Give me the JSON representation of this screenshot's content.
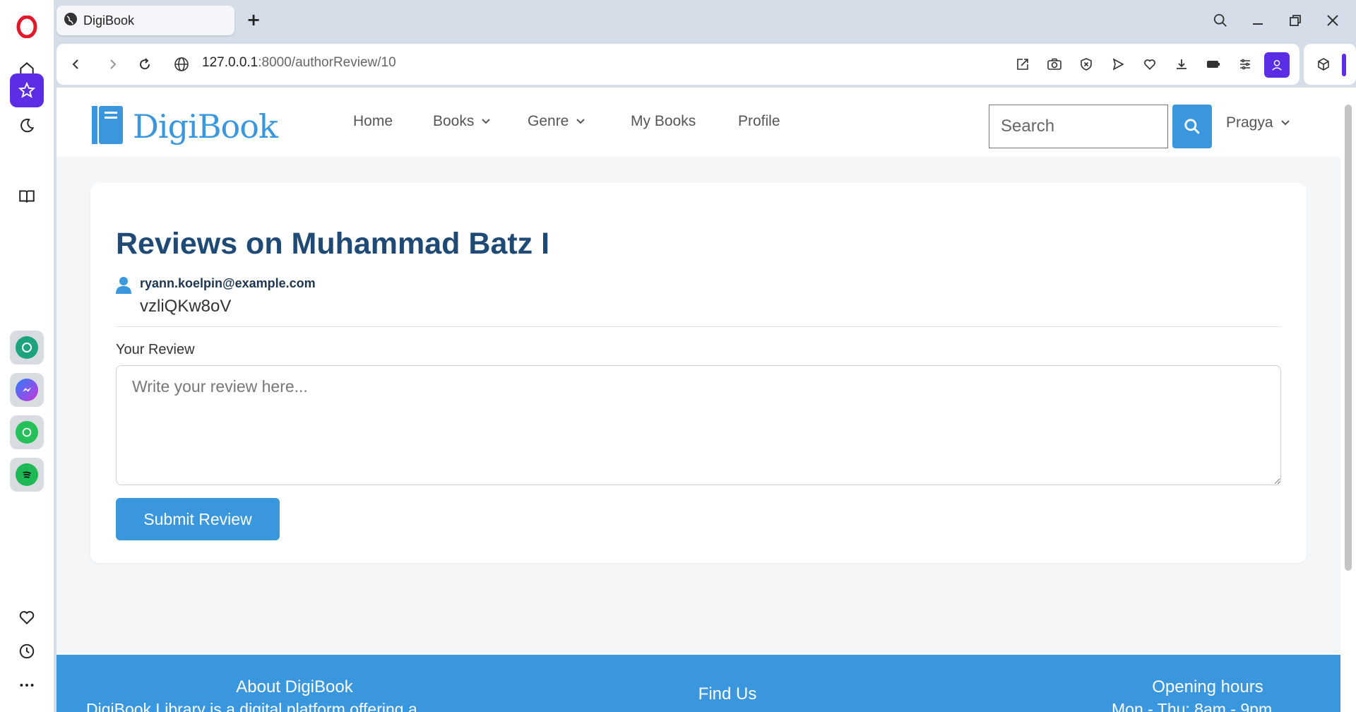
{
  "browser": {
    "tab_title": "DigiBook",
    "url_host": "127.0.0.1",
    "url_path": ":8000/authorReview/10",
    "new_tab": "+"
  },
  "sidebar": {
    "items": [
      "home-icon",
      "star-icon",
      "moon-icon",
      "book-open-icon"
    ],
    "apps": [
      "chatgpt-icon",
      "messenger-icon",
      "whatsapp-icon",
      "spotify-icon"
    ],
    "bottom": [
      "heart-icon",
      "history-icon",
      "more-icon"
    ]
  },
  "site": {
    "brand": "DigiBook",
    "nav": {
      "home": "Home",
      "books": "Books",
      "genre": "Genre",
      "my_books": "My Books",
      "profile": "Profile"
    },
    "search_placeholder": "Search",
    "user": "Pragya"
  },
  "review_page": {
    "title": "Reviews on Muhammad Batz I",
    "reviews": [
      {
        "email": "ryann.koelpin@example.com",
        "text": "vzliQKw8oV"
      }
    ],
    "form": {
      "label": "Your Review",
      "placeholder": "Write your review here...",
      "submit": "Submit Review"
    }
  },
  "footer": {
    "about_title": "About DigiBook",
    "about_text": "DigiBook Library is a digital platform offering a",
    "find_title": "Find Us",
    "hours_title": "Opening hours",
    "hours_text": "Mon - Thu: 8am - 9pm"
  },
  "colors": {
    "accent": "#3a97dd",
    "title": "#1e4a75",
    "opera_purple": "#5b2ee6"
  }
}
